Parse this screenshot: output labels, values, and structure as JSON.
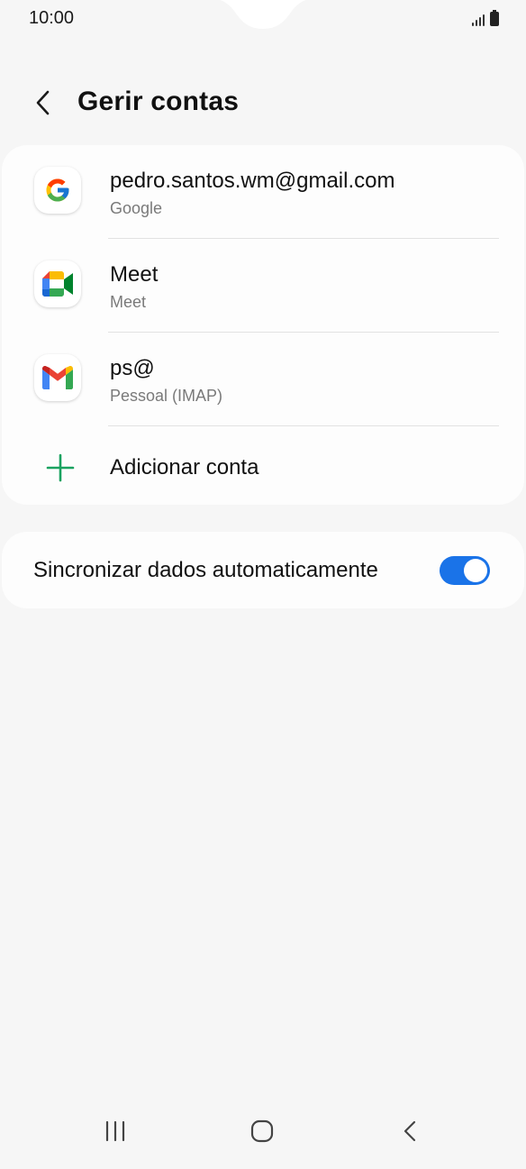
{
  "status_bar": {
    "time": "10:00",
    "icons": [
      "signal-icon",
      "battery-icon"
    ]
  },
  "header": {
    "title": "Gerir contas",
    "back_icon": "chevron-left-icon"
  },
  "accounts": [
    {
      "title": "pedro.santos.wm@gmail.com",
      "subtitle": "Google",
      "icon": "google-icon"
    },
    {
      "title": "Meet",
      "subtitle": "Meet",
      "icon": "meet-icon"
    },
    {
      "title": "ps@",
      "subtitle": "Pessoal (IMAP)",
      "icon": "gmail-icon"
    }
  ],
  "add_account": {
    "label": "Adicionar conta",
    "icon": "plus-icon",
    "color": "#1aa260"
  },
  "sync": {
    "label": "Sincronizar dados automaticamente",
    "enabled": true,
    "toggle_color": "#1a73e8"
  },
  "nav_bar": {
    "icons": [
      "recents-icon",
      "home-icon",
      "back-icon"
    ]
  }
}
